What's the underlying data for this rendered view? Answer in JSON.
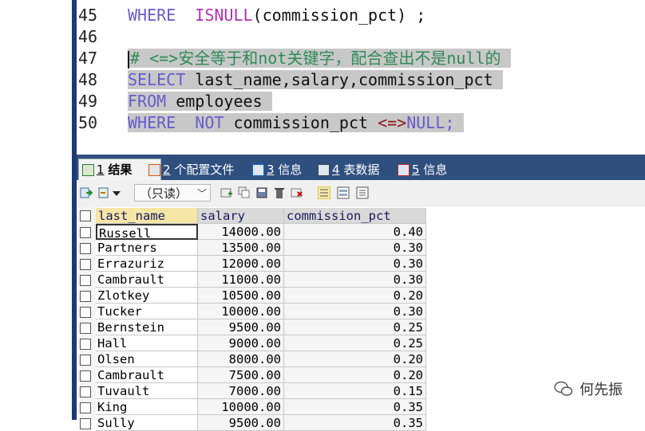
{
  "editor": {
    "lines": [
      {
        "n": "45",
        "parts": [
          {
            "t": "WHERE  ",
            "c": "kw"
          },
          {
            "t": "ISNULL",
            "c": "fn"
          },
          {
            "t": "(commission_pct) ;",
            "c": "tx"
          }
        ],
        "selected": false
      },
      {
        "n": "46",
        "parts": [],
        "selected": false
      },
      {
        "n": "47",
        "parts": [
          {
            "t": "# <=>安全等于和not关键字，配合查出不是null的",
            "c": "cm"
          }
        ],
        "selected": true
      },
      {
        "n": "48",
        "parts": [
          {
            "t": "SELECT ",
            "c": "kw"
          },
          {
            "t": "last_name,salary,commission_pct",
            "c": "tx"
          }
        ],
        "selected": true
      },
      {
        "n": "49",
        "parts": [
          {
            "t": "FROM ",
            "c": "kw"
          },
          {
            "t": "employees",
            "c": "tx"
          }
        ],
        "selected": true
      },
      {
        "n": "50",
        "parts": [
          {
            "t": "WHERE  ",
            "c": "kw"
          },
          {
            "t": "NOT ",
            "c": "kw"
          },
          {
            "t": "commission_pct ",
            "c": "tx"
          },
          {
            "t": "<=>",
            "c": "op"
          },
          {
            "t": "NULL;",
            "c": "kw"
          }
        ],
        "selected": true
      }
    ]
  },
  "tabs": [
    {
      "num": "1",
      "label": "结果",
      "active": true,
      "icon": "result-grid-icon"
    },
    {
      "num": "2",
      "label": "个配置文件",
      "active": false,
      "icon": "profile-icon"
    },
    {
      "num": "3",
      "label": "信息",
      "active": false,
      "icon": "info-icon"
    },
    {
      "num": "4",
      "label": "表数据",
      "active": false,
      "icon": "table-data-icon"
    },
    {
      "num": "5",
      "label": "信息",
      "active": false,
      "icon": "info-2-icon"
    }
  ],
  "toolbar": {
    "mode_select": "（只读）"
  },
  "grid": {
    "columns": [
      "last_name",
      "salary",
      "commission_pct"
    ],
    "rows": [
      [
        "Russell",
        "14000.00",
        "0.40"
      ],
      [
        "Partners",
        "13500.00",
        "0.30"
      ],
      [
        "Errazuriz",
        "12000.00",
        "0.30"
      ],
      [
        "Cambrault",
        "11000.00",
        "0.30"
      ],
      [
        "Zlotkey",
        "10500.00",
        "0.20"
      ],
      [
        "Tucker",
        "10000.00",
        "0.30"
      ],
      [
        "Bernstein",
        "9500.00",
        "0.25"
      ],
      [
        "Hall",
        "9000.00",
        "0.25"
      ],
      [
        "Olsen",
        "8000.00",
        "0.20"
      ],
      [
        "Cambrault",
        "7500.00",
        "0.20"
      ],
      [
        "Tuvault",
        "7000.00",
        "0.15"
      ],
      [
        "King",
        "10000.00",
        "0.35"
      ],
      [
        "Sully",
        "9500.00",
        "0.35"
      ]
    ]
  },
  "watermark": {
    "text": "何先振"
  }
}
